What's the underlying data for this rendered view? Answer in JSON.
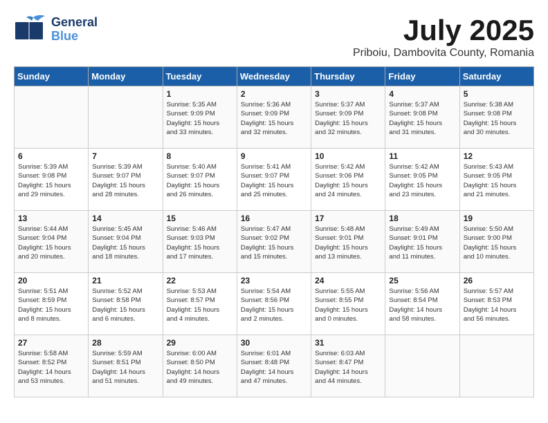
{
  "header": {
    "logo_line1": "General",
    "logo_line2": "Blue",
    "title": "July 2025",
    "subtitle": "Priboiu, Dambovita County, Romania"
  },
  "days_of_week": [
    "Sunday",
    "Monday",
    "Tuesday",
    "Wednesday",
    "Thursday",
    "Friday",
    "Saturday"
  ],
  "weeks": [
    [
      {
        "day": "",
        "info": ""
      },
      {
        "day": "",
        "info": ""
      },
      {
        "day": "1",
        "info": "Sunrise: 5:35 AM\nSunset: 9:09 PM\nDaylight: 15 hours\nand 33 minutes."
      },
      {
        "day": "2",
        "info": "Sunrise: 5:36 AM\nSunset: 9:09 PM\nDaylight: 15 hours\nand 32 minutes."
      },
      {
        "day": "3",
        "info": "Sunrise: 5:37 AM\nSunset: 9:09 PM\nDaylight: 15 hours\nand 32 minutes."
      },
      {
        "day": "4",
        "info": "Sunrise: 5:37 AM\nSunset: 9:08 PM\nDaylight: 15 hours\nand 31 minutes."
      },
      {
        "day": "5",
        "info": "Sunrise: 5:38 AM\nSunset: 9:08 PM\nDaylight: 15 hours\nand 30 minutes."
      }
    ],
    [
      {
        "day": "6",
        "info": "Sunrise: 5:39 AM\nSunset: 9:08 PM\nDaylight: 15 hours\nand 29 minutes."
      },
      {
        "day": "7",
        "info": "Sunrise: 5:39 AM\nSunset: 9:07 PM\nDaylight: 15 hours\nand 28 minutes."
      },
      {
        "day": "8",
        "info": "Sunrise: 5:40 AM\nSunset: 9:07 PM\nDaylight: 15 hours\nand 26 minutes."
      },
      {
        "day": "9",
        "info": "Sunrise: 5:41 AM\nSunset: 9:07 PM\nDaylight: 15 hours\nand 25 minutes."
      },
      {
        "day": "10",
        "info": "Sunrise: 5:42 AM\nSunset: 9:06 PM\nDaylight: 15 hours\nand 24 minutes."
      },
      {
        "day": "11",
        "info": "Sunrise: 5:42 AM\nSunset: 9:05 PM\nDaylight: 15 hours\nand 23 minutes."
      },
      {
        "day": "12",
        "info": "Sunrise: 5:43 AM\nSunset: 9:05 PM\nDaylight: 15 hours\nand 21 minutes."
      }
    ],
    [
      {
        "day": "13",
        "info": "Sunrise: 5:44 AM\nSunset: 9:04 PM\nDaylight: 15 hours\nand 20 minutes."
      },
      {
        "day": "14",
        "info": "Sunrise: 5:45 AM\nSunset: 9:04 PM\nDaylight: 15 hours\nand 18 minutes."
      },
      {
        "day": "15",
        "info": "Sunrise: 5:46 AM\nSunset: 9:03 PM\nDaylight: 15 hours\nand 17 minutes."
      },
      {
        "day": "16",
        "info": "Sunrise: 5:47 AM\nSunset: 9:02 PM\nDaylight: 15 hours\nand 15 minutes."
      },
      {
        "day": "17",
        "info": "Sunrise: 5:48 AM\nSunset: 9:01 PM\nDaylight: 15 hours\nand 13 minutes."
      },
      {
        "day": "18",
        "info": "Sunrise: 5:49 AM\nSunset: 9:01 PM\nDaylight: 15 hours\nand 11 minutes."
      },
      {
        "day": "19",
        "info": "Sunrise: 5:50 AM\nSunset: 9:00 PM\nDaylight: 15 hours\nand 10 minutes."
      }
    ],
    [
      {
        "day": "20",
        "info": "Sunrise: 5:51 AM\nSunset: 8:59 PM\nDaylight: 15 hours\nand 8 minutes."
      },
      {
        "day": "21",
        "info": "Sunrise: 5:52 AM\nSunset: 8:58 PM\nDaylight: 15 hours\nand 6 minutes."
      },
      {
        "day": "22",
        "info": "Sunrise: 5:53 AM\nSunset: 8:57 PM\nDaylight: 15 hours\nand 4 minutes."
      },
      {
        "day": "23",
        "info": "Sunrise: 5:54 AM\nSunset: 8:56 PM\nDaylight: 15 hours\nand 2 minutes."
      },
      {
        "day": "24",
        "info": "Sunrise: 5:55 AM\nSunset: 8:55 PM\nDaylight: 15 hours\nand 0 minutes."
      },
      {
        "day": "25",
        "info": "Sunrise: 5:56 AM\nSunset: 8:54 PM\nDaylight: 14 hours\nand 58 minutes."
      },
      {
        "day": "26",
        "info": "Sunrise: 5:57 AM\nSunset: 8:53 PM\nDaylight: 14 hours\nand 56 minutes."
      }
    ],
    [
      {
        "day": "27",
        "info": "Sunrise: 5:58 AM\nSunset: 8:52 PM\nDaylight: 14 hours\nand 53 minutes."
      },
      {
        "day": "28",
        "info": "Sunrise: 5:59 AM\nSunset: 8:51 PM\nDaylight: 14 hours\nand 51 minutes."
      },
      {
        "day": "29",
        "info": "Sunrise: 6:00 AM\nSunset: 8:50 PM\nDaylight: 14 hours\nand 49 minutes."
      },
      {
        "day": "30",
        "info": "Sunrise: 6:01 AM\nSunset: 8:48 PM\nDaylight: 14 hours\nand 47 minutes."
      },
      {
        "day": "31",
        "info": "Sunrise: 6:03 AM\nSunset: 8:47 PM\nDaylight: 14 hours\nand 44 minutes."
      },
      {
        "day": "",
        "info": ""
      },
      {
        "day": "",
        "info": ""
      }
    ]
  ]
}
